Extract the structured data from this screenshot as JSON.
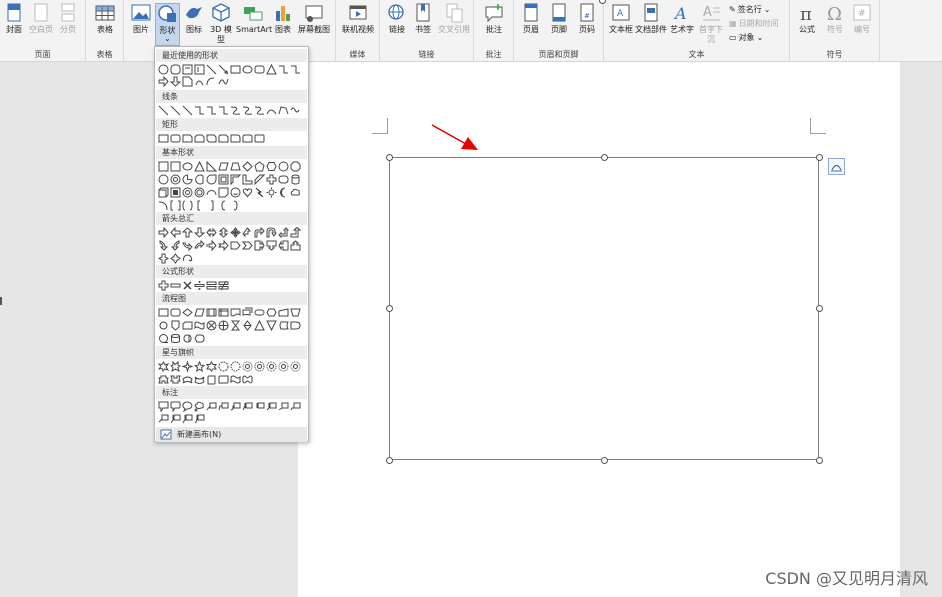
{
  "ribbon": {
    "groups": {
      "pages": {
        "label": "页面",
        "items": [
          "封面",
          "空白页",
          "分页"
        ]
      },
      "tables": {
        "label": "表格",
        "items": [
          "表格"
        ]
      },
      "illustrations": {
        "items": [
          "图片",
          "形状",
          "图标",
          "3D 模型",
          "SmartArt",
          "图表",
          "屏幕截图"
        ]
      },
      "media": {
        "label": "媒体",
        "items": [
          "联机视频"
        ]
      },
      "links": {
        "label": "链接",
        "items": [
          "链接",
          "书签",
          "交叉引用"
        ]
      },
      "comments": {
        "label": "批注",
        "items": [
          "批注"
        ]
      },
      "header_footer": {
        "label": "页眉和页脚",
        "items": [
          "页眉",
          "页脚",
          "页码"
        ]
      },
      "text": {
        "label": "文本",
        "items": [
          "文本框",
          "文档部件",
          "艺术字",
          "首字下沉"
        ],
        "side": [
          "签名行",
          "日期和时间",
          "对象"
        ]
      },
      "symbols": {
        "label": "符号",
        "items": [
          "公式",
          "符号",
          "编号"
        ]
      }
    },
    "chevron": "⌄"
  },
  "shapes_menu": {
    "categories": [
      "最近使用的形状",
      "线条",
      "矩形",
      "基本形状",
      "箭头总汇",
      "公式形状",
      "流程图",
      "星与旗帜",
      "标注"
    ],
    "new_canvas": "新建画布(N)"
  },
  "watermark": "CSDN @又见明月清风",
  "colors": {
    "arrow": "#e60000",
    "selected": "#c5d7ee"
  }
}
